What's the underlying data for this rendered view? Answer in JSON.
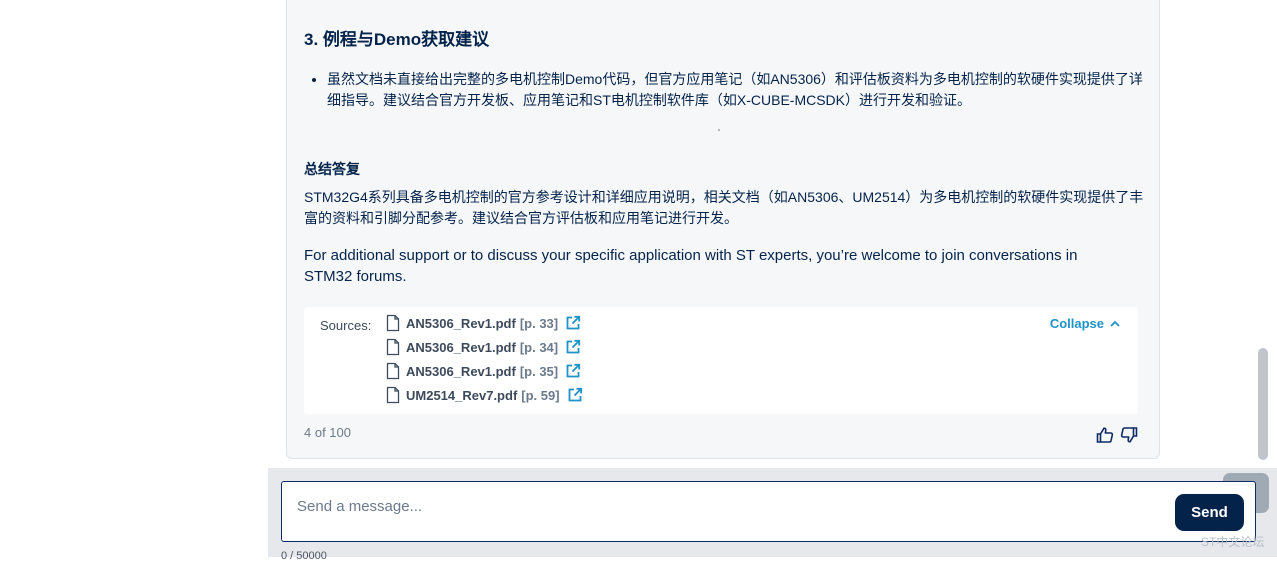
{
  "answer": {
    "section_heading": "3. 例程与Demo获取建议",
    "bullets": [
      "虽然文档未直接给出完整的多电机控制Demo代码，但官方应用笔记（如AN5306）和评估板资料为多电机控制的软硬件实现提供了详细指导。建议结合官方开发板、应用笔记和ST电机控制软件库（如X-CUBE-MCSDK）进行开发和验证。"
    ],
    "summary_title": "总结答复",
    "summary_text": "STM32G4系列具备多电机控制的官方参考设计和详细应用说明，相关文档（如AN5306、UM2514）为多电机控制的软硬件实现提供了丰富的资料和引脚分配参考。建议结合官方评估板和应用笔记进行开发。",
    "support_text": "For additional support or to discuss your specific application with ST experts, you’re welcome to join conversations in STM32 forums."
  },
  "sources": {
    "label": "Sources:",
    "collapse_label": "Collapse",
    "items": [
      {
        "file": "AN5306_Rev1.pdf",
        "page": "[p. 33]"
      },
      {
        "file": "AN5306_Rev1.pdf",
        "page": "[p. 34]"
      },
      {
        "file": "AN5306_Rev1.pdf",
        "page": "[p. 35]"
      },
      {
        "file": "UM2514_Rev7.pdf",
        "page": "[p. 59]"
      }
    ]
  },
  "footer": {
    "counter": "4 of 100"
  },
  "composer": {
    "placeholder": "Send a message...",
    "send_label": "Send",
    "char_count": "0 / 50000"
  },
  "watermark": "ST中文论坛",
  "icons": {
    "document": "document-icon",
    "external": "external-link-icon",
    "chevron": "chevron-up-icon",
    "thumbs_up": "thumbs-up-icon",
    "thumbs_down": "thumbs-down-icon"
  },
  "colors": {
    "navy": "#03234b",
    "accent_blue": "#1f93c9",
    "card_bg": "#f6f7f9"
  }
}
